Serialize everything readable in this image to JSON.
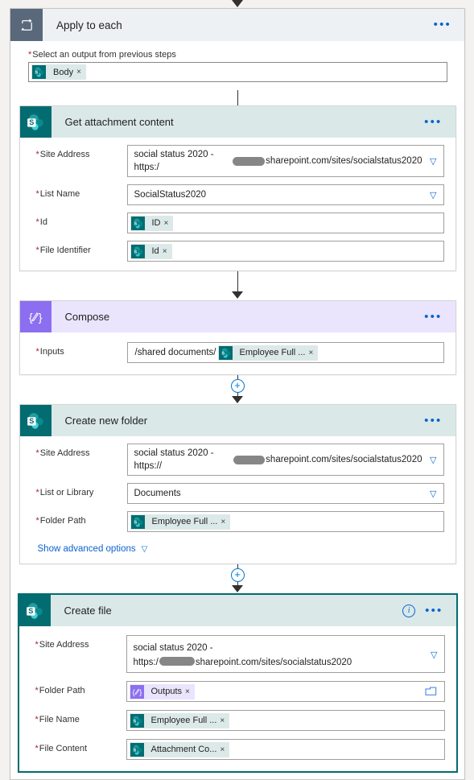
{
  "flow": {
    "loop": {
      "title": "Apply to each",
      "icon": "loop-icon",
      "menu": "•••",
      "input_label": "Select an output from previous steps",
      "required_star": "*",
      "token": {
        "text": "Body",
        "remove": "×",
        "icon": "sharepoint-icon"
      }
    },
    "actions": [
      {
        "id": "get-attachment-content",
        "title": "Get attachment content",
        "connector": "sharepoint",
        "icon": "sharepoint-icon",
        "menu": "•••",
        "selected": false,
        "fields": [
          {
            "label": "Site Address",
            "required": true,
            "type": "combo",
            "value_before": "social status 2020 - https:/",
            "redacted": true,
            "value_after": "sharepoint.com/sites/socialstatus2020",
            "chevron": "chevron-down-icon"
          },
          {
            "label": "List Name",
            "required": true,
            "type": "combo",
            "value_before": "SocialStatus2020",
            "redacted": false,
            "value_after": "",
            "chevron": "chevron-down-icon"
          },
          {
            "label": "Id",
            "required": true,
            "type": "token",
            "prefix": "",
            "token": {
              "text": "ID",
              "remove": "×",
              "icon": "sharepoint-icon",
              "style": "teal"
            }
          },
          {
            "label": "File Identifier",
            "required": true,
            "type": "token",
            "prefix": "",
            "token": {
              "text": "Id",
              "remove": "×",
              "icon": "sharepoint-icon",
              "style": "teal"
            }
          }
        ]
      },
      {
        "id": "compose",
        "title": "Compose",
        "connector": "compose",
        "icon": "compose-icon",
        "menu": "•••",
        "selected": false,
        "fields": [
          {
            "label": "Inputs",
            "required": true,
            "type": "token",
            "prefix": "/shared documents/",
            "token": {
              "text": "Employee Full ...",
              "remove": "×",
              "icon": "sharepoint-icon",
              "style": "teal"
            }
          }
        ]
      },
      {
        "id": "create-new-folder",
        "title": "Create new folder",
        "connector": "sharepoint",
        "icon": "sharepoint-icon",
        "menu": "•••",
        "selected": false,
        "advanced_link": "Show advanced options",
        "fields": [
          {
            "label": "Site Address",
            "required": true,
            "type": "combo",
            "value_before": "social status 2020 - https://",
            "redacted": true,
            "value_after": "sharepoint.com/sites/socialstatus2020",
            "chevron": "chevron-down-icon"
          },
          {
            "label": "List or Library",
            "required": true,
            "type": "combo",
            "value_before": "Documents",
            "redacted": false,
            "value_after": "",
            "chevron": "chevron-down-icon"
          },
          {
            "label": "Folder Path",
            "required": true,
            "type": "token",
            "prefix": "",
            "token": {
              "text": "Employee Full ...",
              "remove": "×",
              "icon": "sharepoint-icon",
              "style": "teal"
            }
          }
        ]
      },
      {
        "id": "create-file",
        "title": "Create file",
        "connector": "sharepoint",
        "icon": "sharepoint-icon",
        "menu": "•••",
        "info": "i",
        "selected": true,
        "fields": [
          {
            "label": "Site Address",
            "required": true,
            "type": "combo-tall",
            "value_before": "social status 2020 -",
            "value_line2_before": "https:/",
            "redacted": true,
            "value_after": "sharepoint.com/sites/socialstatus2020",
            "chevron": "chevron-down-icon"
          },
          {
            "label": "Folder Path",
            "required": true,
            "type": "token-folder",
            "prefix": "",
            "picker_icon": "folder-picker-icon",
            "token": {
              "text": "Outputs",
              "remove": "×",
              "icon": "compose-icon",
              "style": "purple"
            }
          },
          {
            "label": "File Name",
            "required": true,
            "type": "token",
            "prefix": "",
            "token": {
              "text": "Employee Full ...",
              "remove": "×",
              "icon": "sharepoint-icon",
              "style": "teal"
            }
          },
          {
            "label": "File Content",
            "required": true,
            "type": "token",
            "prefix": "",
            "token": {
              "text": "Attachment Co...",
              "remove": "×",
              "icon": "sharepoint-icon",
              "style": "teal"
            }
          }
        ]
      }
    ],
    "add_step_label": "+"
  },
  "colors": {
    "sharepoint_teal": "#036c70",
    "sharepoint_header": "#dae8e8",
    "compose_purple": "#8c6ff0",
    "compose_header": "#eae4fc",
    "loop_slate": "#59687b",
    "accent_blue": "#0b63ce",
    "required_red": "#a4262c",
    "canvas": "#f3f2f1"
  }
}
